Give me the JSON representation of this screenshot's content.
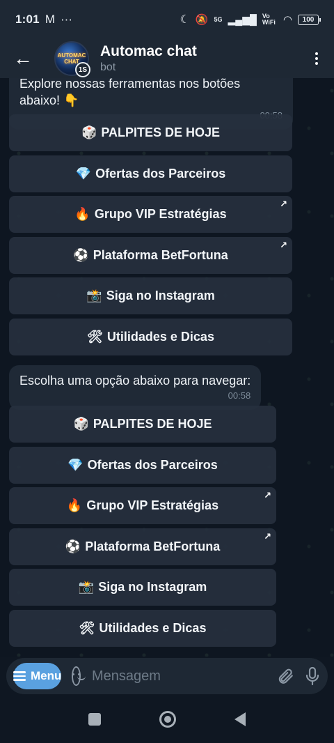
{
  "status_bar": {
    "time": "1:01",
    "notif_icon": "M",
    "dots": "···",
    "network": "5G",
    "vowifi": "Vo WiFi",
    "battery": "100"
  },
  "header": {
    "title": "Automac chat",
    "subtitle": "bot",
    "avatar_logo": "AUTOMAC CHAT",
    "avatar_timer": "1S"
  },
  "messages": [
    {
      "text": "Explore nossas ferramentas nos botões abaixo! 👇",
      "time": "00:58"
    },
    {
      "text": "Escolha uma opção abaixo para navegar:",
      "time": "00:58"
    }
  ],
  "keyboard_1": [
    {
      "emoji": "🎲",
      "label": "PALPITES DE HOJE",
      "link": false
    },
    {
      "emoji": "💎",
      "label": "Ofertas dos Parceiros",
      "link": false
    },
    {
      "emoji": "🔥",
      "label": "Grupo VIP Estratégias",
      "link": true
    },
    {
      "emoji": "⚽",
      "label": "Plataforma BetFortuna",
      "link": true
    },
    {
      "emoji": "📸",
      "label": "Siga no Instagram",
      "link": false
    },
    {
      "emoji": "🛠",
      "label": "Utilidades e Dicas",
      "link": false
    }
  ],
  "keyboard_2": [
    {
      "emoji": "🎲",
      "label": "PALPITES DE HOJE",
      "link": false
    },
    {
      "emoji": "💎",
      "label": "Ofertas dos Parceiros",
      "link": false
    },
    {
      "emoji": "🔥",
      "label": "Grupo VIP Estratégias",
      "link": true
    },
    {
      "emoji": "⚽",
      "label": "Plataforma BetFortuna",
      "link": true
    },
    {
      "emoji": "📸",
      "label": "Siga no Instagram",
      "link": false
    },
    {
      "emoji": "🛠",
      "label": "Utilidades e Dicas",
      "link": false
    }
  ],
  "link_arrow": "↗",
  "input_bar": {
    "menu_label": "Menu",
    "placeholder": "Mensagem"
  },
  "colors": {
    "accent": "#5aa1e0",
    "header_bg": "#1e2834",
    "bubble_bg": "#1f2936"
  }
}
